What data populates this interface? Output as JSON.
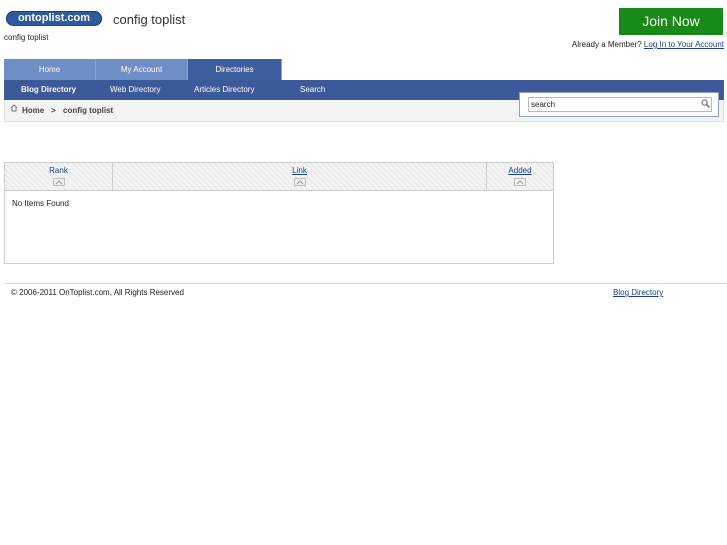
{
  "header": {
    "logo_text": "ontoplist.com",
    "title": "config toplist",
    "subtitle": "config toplist",
    "join_label": "Join Now",
    "member_text": "Already a Member?",
    "login_link": "Log In to Your Account"
  },
  "tabs": [
    {
      "label": "Home"
    },
    {
      "label": "My Account"
    },
    {
      "label": "Directories"
    }
  ],
  "subnav": [
    {
      "label": "Blog Directory"
    },
    {
      "label": "Web Directory"
    },
    {
      "label": "Articles Directory"
    },
    {
      "label": "Search"
    }
  ],
  "breadcrumb": {
    "home": "Home",
    "separator": ">",
    "current": "config toplist"
  },
  "search": {
    "value": "search"
  },
  "table": {
    "columns": [
      {
        "label": "Rank"
      },
      {
        "label": "Link"
      },
      {
        "label": "Added"
      }
    ],
    "empty_message": "No Items Found"
  },
  "footer": {
    "copyright": "© 2006-2011 OnToplist.com, All Rights Reserved",
    "link": "Blog Directory"
  },
  "colors": {
    "brand_blue": "#2f5a9c",
    "nav_blue": "#3c5a99",
    "join_green": "#178a17"
  }
}
